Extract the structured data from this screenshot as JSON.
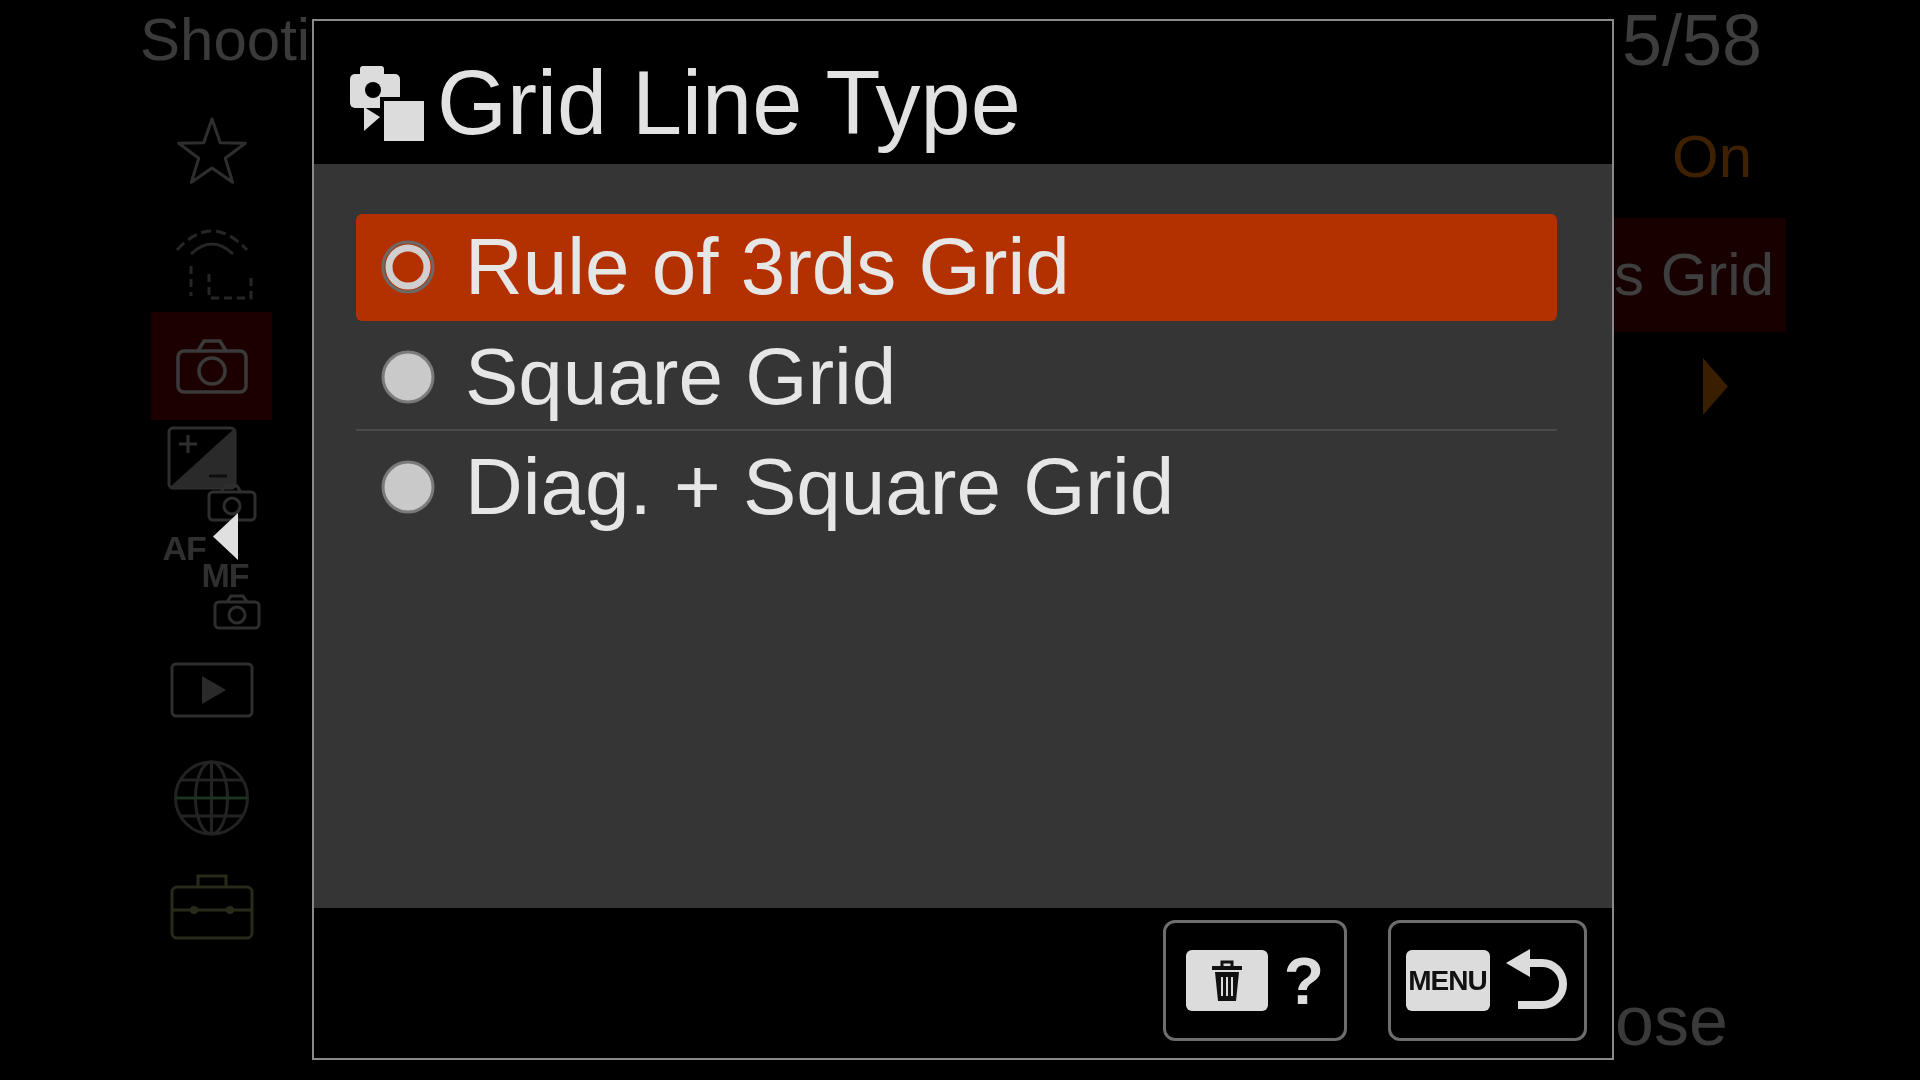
{
  "background_menu": {
    "title": "Shooti",
    "page": "5/58",
    "tabs": [
      {
        "kind": "star",
        "selected": false
      },
      {
        "kind": "custom",
        "selected": false
      },
      {
        "kind": "camera",
        "selected": true
      },
      {
        "kind": "exposure",
        "selected": false
      },
      {
        "kind": "focus",
        "selected": false,
        "labels": [
          "AF",
          "MF"
        ]
      },
      {
        "kind": "playback",
        "selected": false
      },
      {
        "kind": "network",
        "selected": false
      },
      {
        "kind": "setup",
        "selected": false
      }
    ],
    "rows": [
      {
        "value": "On",
        "selected": false
      },
      {
        "value": "s Grid",
        "selected": true
      }
    ],
    "footer_hint": "ose"
  },
  "dialog": {
    "title": "Grid Line Type",
    "options": [
      {
        "label": "Rule of 3rds Grid",
        "selected": true
      },
      {
        "label": "Square Grid",
        "selected": false
      },
      {
        "label": "Diag. + Square Grid",
        "selected": false
      }
    ],
    "buttons": [
      {
        "kind": "help",
        "label": "?"
      },
      {
        "kind": "back",
        "label": "MENU"
      }
    ]
  }
}
